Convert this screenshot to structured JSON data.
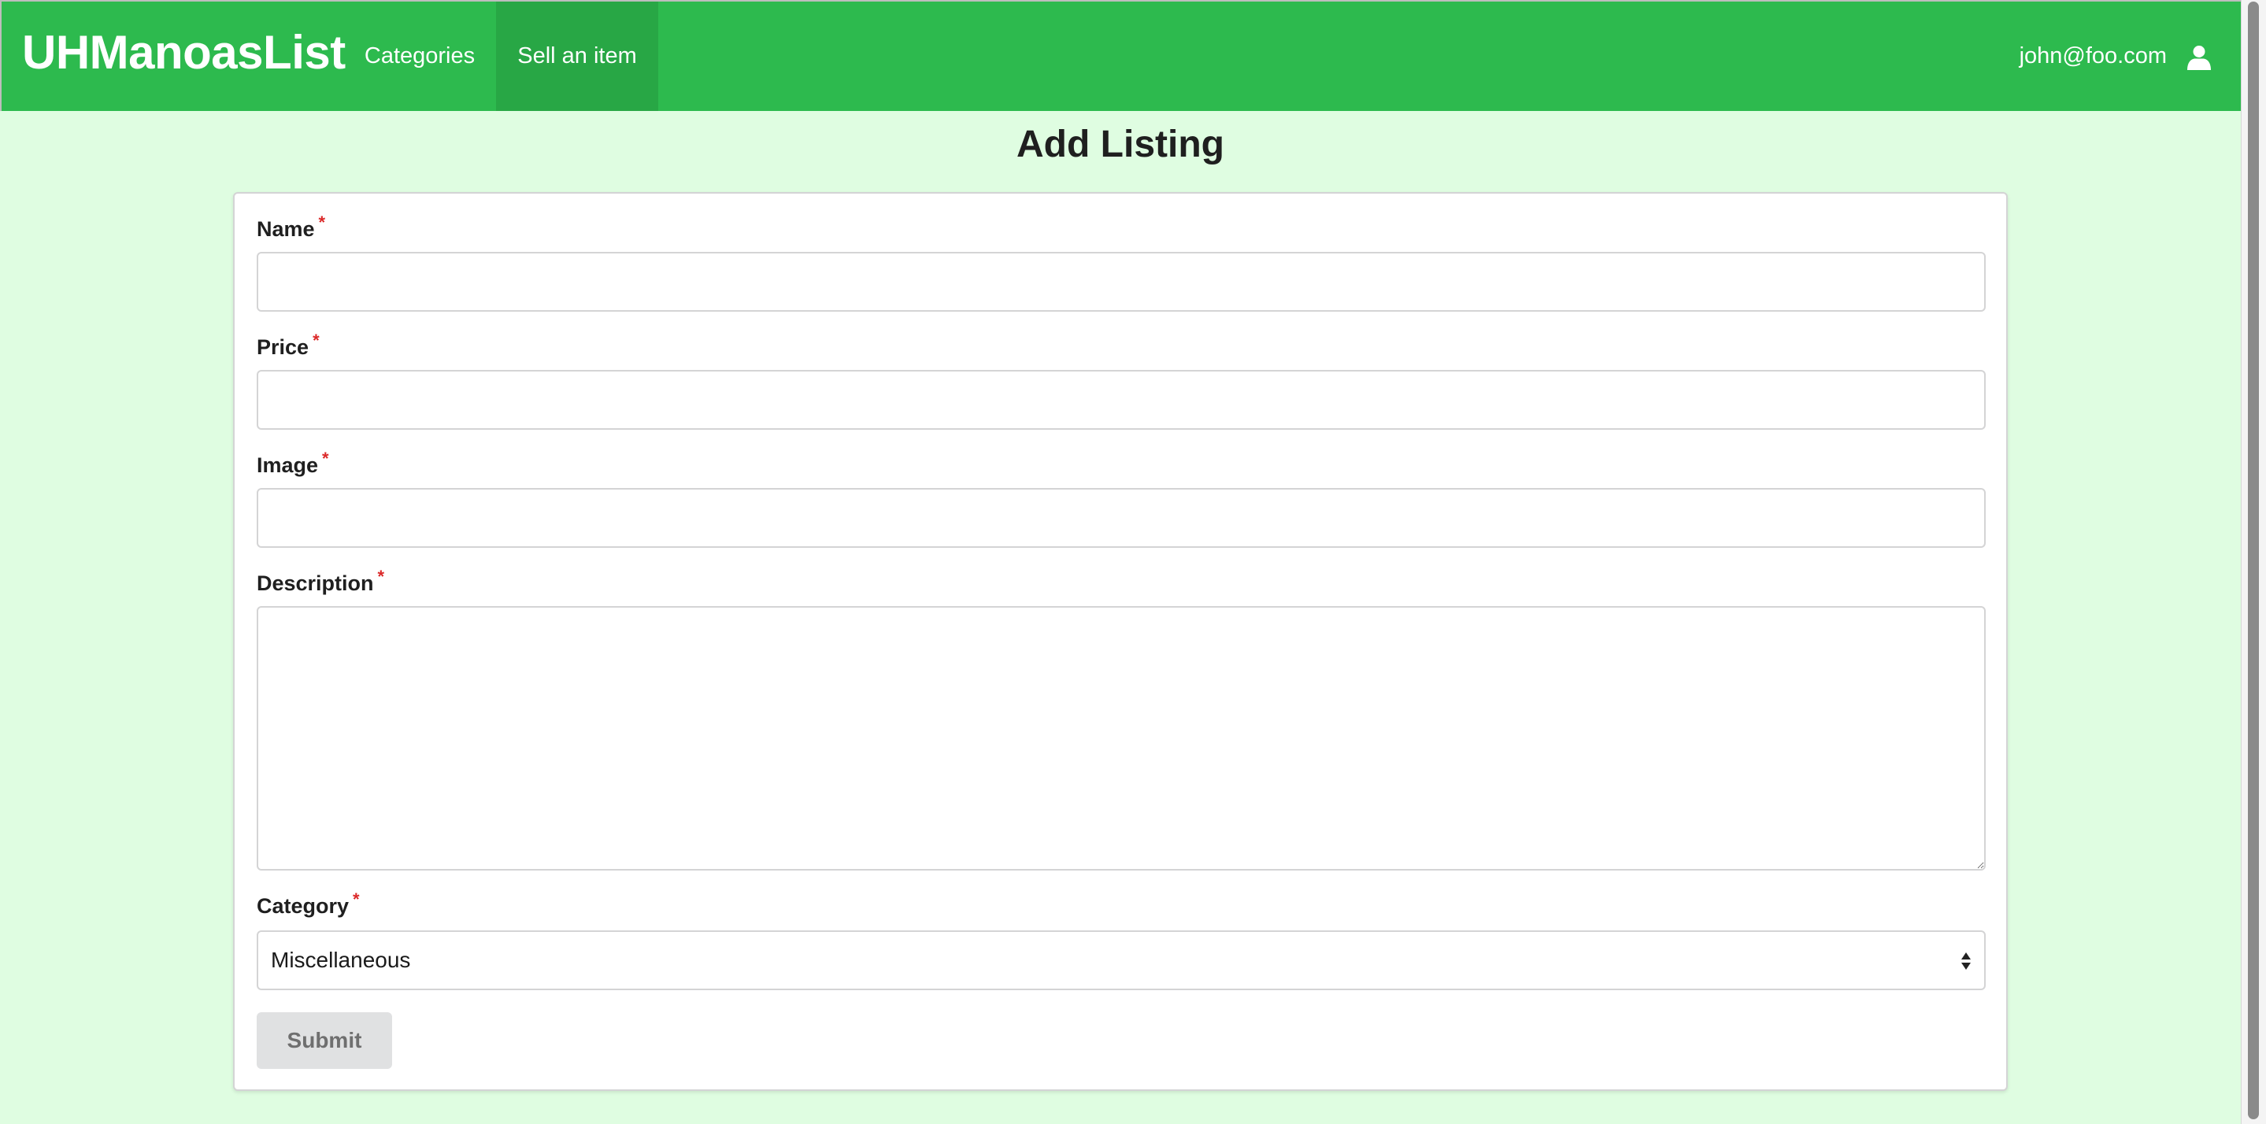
{
  "navbar": {
    "brand": "UHManoasList",
    "items": [
      {
        "label": "Categories",
        "active": false
      },
      {
        "label": "Sell an item",
        "active": true
      }
    ],
    "user_email": "john@foo.com",
    "user_icon": "user-icon"
  },
  "page": {
    "title": "Add Listing"
  },
  "form": {
    "required_marker": "*",
    "fields": {
      "name": {
        "label": "Name",
        "value": ""
      },
      "price": {
        "label": "Price",
        "value": ""
      },
      "image": {
        "label": "Image",
        "value": ""
      },
      "description": {
        "label": "Description",
        "value": ""
      },
      "category": {
        "label": "Category",
        "selected": "Miscellaneous"
      }
    },
    "submit_label": "Submit"
  },
  "colors": {
    "navbar": "#2dba4e",
    "navbar_active": "#28a745",
    "background": "#dffde1",
    "required": "#db2828",
    "submit_bg": "#e0e1e2"
  }
}
